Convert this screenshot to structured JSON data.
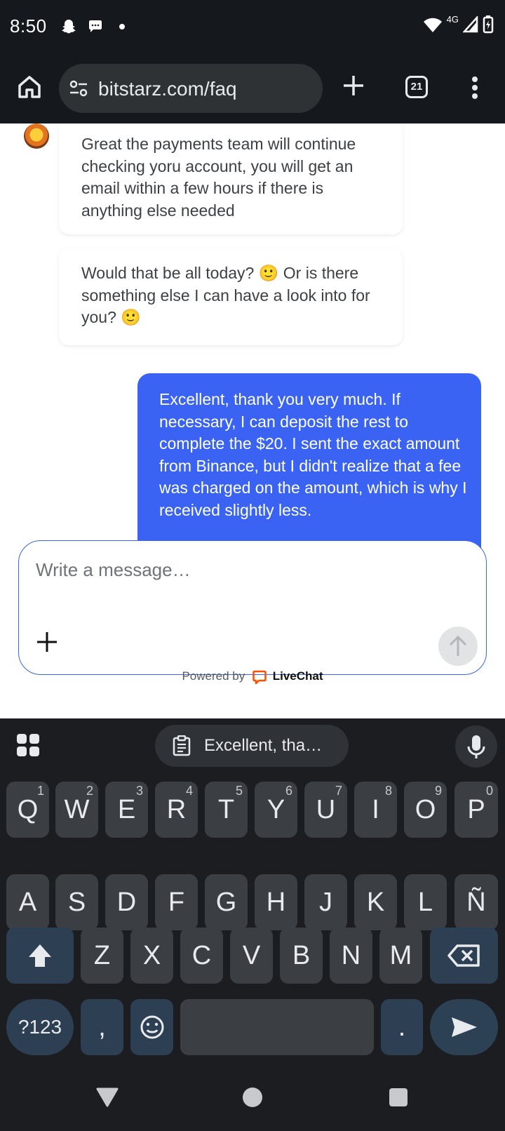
{
  "status_bar": {
    "time": "8:50",
    "network": "4G",
    "icons": [
      "snapchat-icon",
      "chat-bubble-icon",
      "dot-icon",
      "wifi-icon",
      "signal-icon",
      "battery-icon"
    ]
  },
  "browser": {
    "url": "bitstarz.com/faq",
    "tab_count": "21",
    "icons": [
      "home-icon",
      "site-settings-icon",
      "new-tab-icon",
      "tab-switcher-icon",
      "more-menu-icon"
    ]
  },
  "chat": {
    "messages": [
      {
        "sender": "agent",
        "text": "Great the payments team will continue checking yoru account, you will get an email within a few hours if there is anything else needed"
      },
      {
        "sender": "agent",
        "text": "Would that be all today? 🙂 Or is there something else I can have a look into for you? 🙂"
      },
      {
        "sender": "user",
        "text": "Excellent, thank you very much. If necessary, I can deposit the rest to complete the $20. I sent the exact amount from Binance, but I didn't realize that a fee was charged on the amount, which is why I received slightly less."
      }
    ],
    "composer": {
      "placeholder": "Write a message…"
    },
    "powered_by": "Powered by",
    "brand": "LiveChat",
    "colors": {
      "user_bubble": "#3a63f4",
      "brand": "#ff5100"
    }
  },
  "keyboard": {
    "suggestion": "Excellent, tha…",
    "row1": [
      {
        "label": "Q",
        "hint": "1"
      },
      {
        "label": "W",
        "hint": "2"
      },
      {
        "label": "E",
        "hint": "3"
      },
      {
        "label": "R",
        "hint": "4"
      },
      {
        "label": "T",
        "hint": "5"
      },
      {
        "label": "Y",
        "hint": "6"
      },
      {
        "label": "U",
        "hint": "7"
      },
      {
        "label": "I",
        "hint": "8"
      },
      {
        "label": "O",
        "hint": "9"
      },
      {
        "label": "P",
        "hint": "0"
      }
    ],
    "row2": [
      "A",
      "S",
      "D",
      "F",
      "G",
      "H",
      "J",
      "K",
      "L",
      "Ñ"
    ],
    "row3": [
      "Z",
      "X",
      "C",
      "V",
      "B",
      "N",
      "M"
    ],
    "symbols_key": "?123",
    "comma_key": ",",
    "period_key": "."
  }
}
